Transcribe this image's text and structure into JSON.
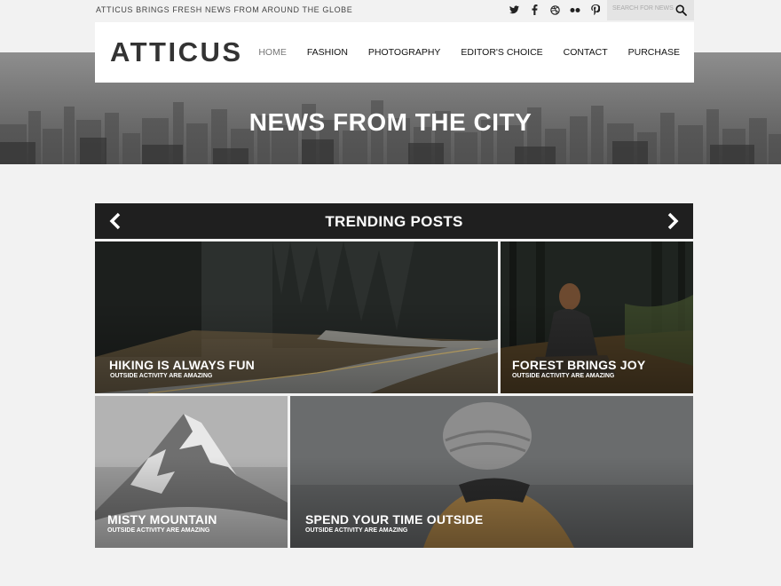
{
  "topbar": {
    "tagline": "ATTICUS BRINGS FRESH NEWS FROM AROUND THE GLOBE",
    "socials": [
      "twitter-icon",
      "facebook-icon",
      "dribbble-icon",
      "flickr-icon",
      "pinterest-icon"
    ],
    "search_placeholder": "SEARCH FOR NEWS"
  },
  "header": {
    "logo": "ATTICUS",
    "nav": [
      "HOME",
      "FASHION",
      "PHOTOGRAPHY",
      "EDITOR'S CHOICE",
      "CONTACT",
      "PURCHASE"
    ],
    "active_nav": "HOME"
  },
  "hero": {
    "title": "NEWS FROM THE CITY"
  },
  "trending": {
    "title": "TRENDING POSTS"
  },
  "posts": [
    {
      "title": "HIKING IS ALWAYS FUN",
      "subtitle": "OUTSIDE ACTIVITY ARE AMAZING"
    },
    {
      "title": "FOREST BRINGS JOY",
      "subtitle": "OUTSIDE ACTIVITY ARE AMAZING"
    },
    {
      "title": "MISTY MOUNTAIN",
      "subtitle": "OUTSIDE ACTIVITY ARE AMAZING"
    },
    {
      "title": "SPEND YOUR TIME OUTSIDE",
      "subtitle": "OUTSIDE ACTIVITY ARE AMAZING"
    }
  ],
  "colors": {
    "page_bg": "#f2f2f2",
    "trending_bar": "#1f1f1f",
    "nav_active": "#777777",
    "accent_white": "#ffffff"
  }
}
